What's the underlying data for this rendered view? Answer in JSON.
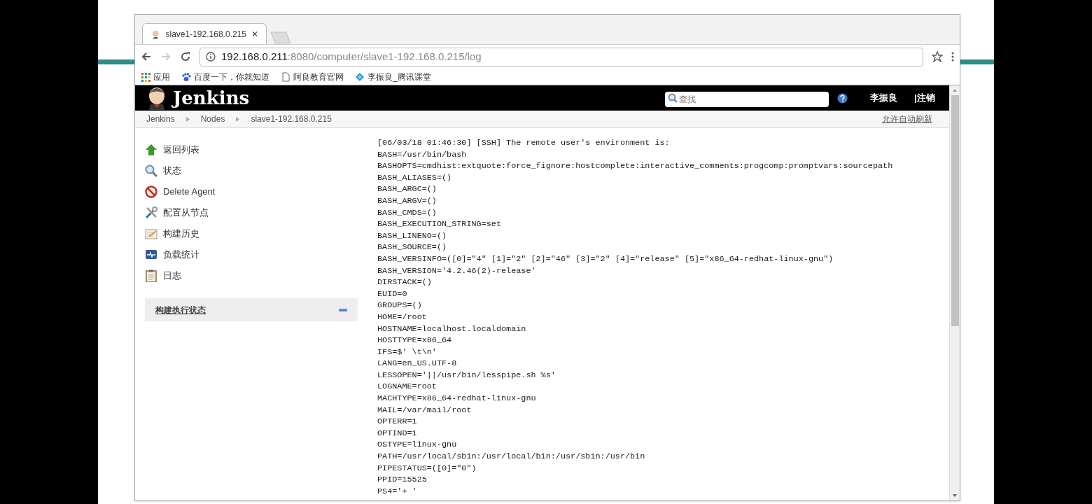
{
  "browser": {
    "tabs": [
      {
        "title": "slave1-192.168.0.215",
        "selected": true
      }
    ],
    "address": {
      "host": "192.168.0.211",
      "path": ":8080/computer/slave1-192.168.0.215/log"
    },
    "bookmarks": [
      {
        "kind": "apps",
        "label": "应用"
      },
      {
        "kind": "paw",
        "label": "百度一下，你就知道"
      },
      {
        "kind": "page",
        "label": "阿良教育官网"
      },
      {
        "kind": "diamond",
        "label": "李振良_腾讯课堂"
      }
    ]
  },
  "header": {
    "brand": "Jenkins",
    "search": {
      "placeholder": "查找"
    },
    "user": "李振良",
    "logout": "|注销"
  },
  "breadcrumbs": [
    "Jenkins",
    "Nodes",
    "slave1-192.168.0.215"
  ],
  "auto_refresh": "允许自动刷新",
  "sidebar": {
    "items": [
      {
        "kind": "up",
        "label": "返回列表"
      },
      {
        "kind": "search",
        "label": "状态"
      },
      {
        "kind": "delete",
        "label": "Delete Agent"
      },
      {
        "kind": "tools",
        "label": "配置从节点"
      },
      {
        "kind": "notepad",
        "label": "构建历史"
      },
      {
        "kind": "monitor",
        "label": "负载统计"
      },
      {
        "kind": "clipboard",
        "label": "日志"
      }
    ],
    "panel": {
      "title": "构建执行状态",
      "expanded": true
    }
  },
  "log": [
    "[06/03/18 01:46:30] [SSH] The remote user's environment is:",
    "BASH=/usr/bin/bash",
    "BASHOPTS=cmdhist:extquote:force_fignore:hostcomplete:interactive_comments:progcomp:promptvars:sourcepath",
    "BASH_ALIASES=()",
    "BASH_ARGC=()",
    "BASH_ARGV=()",
    "BASH_CMDS=()",
    "BASH_EXECUTION_STRING=set",
    "BASH_LINENO=()",
    "BASH_SOURCE=()",
    "BASH_VERSINFO=([0]=\"4\" [1]=\"2\" [2]=\"46\" [3]=\"2\" [4]=\"release\" [5]=\"x86_64-redhat-linux-gnu\")",
    "BASH_VERSION='4.2.46(2)-release'",
    "DIRSTACK=()",
    "EUID=0",
    "GROUPS=()",
    "HOME=/root",
    "HOSTNAME=localhost.localdomain",
    "HOSTTYPE=x86_64",
    "IFS=$' \\t\\n'",
    "LANG=en_US.UTF-8",
    "LESSOPEN='||/usr/bin/lesspipe.sh %s'",
    "LOGNAME=root",
    "MACHTYPE=x86_64-redhat-linux-gnu",
    "MAIL=/var/mail/root",
    "OPTERR=1",
    "OPTIND=1",
    "OSTYPE=linux-gnu",
    "PATH=/usr/local/sbin:/usr/local/bin:/usr/sbin:/usr/bin",
    "PIPESTATUS=([0]=\"0\")",
    "PPID=15525",
    "PS4='+ '"
  ]
}
